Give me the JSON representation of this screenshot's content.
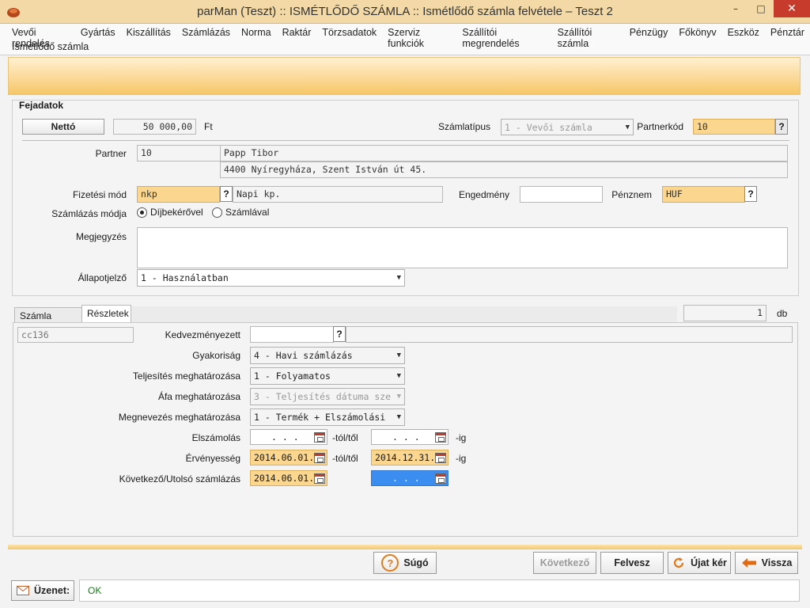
{
  "window": {
    "title": "parMan (Teszt) :: ISMÉTLŐDŐ SZÁMLA :: Ismétlődő számla felvétele   –   Teszt 2",
    "controls": {
      "minimize": "–",
      "maximize": "□",
      "close": "✕"
    }
  },
  "menu": {
    "row1": [
      "Vevői rendelés",
      "Gyártás",
      "Kiszállítás",
      "Számlázás",
      "Norma",
      "Raktár",
      "Törzsadatok",
      "Szerviz funkciók",
      "Szállítói megrendelés",
      "Szállítói számla",
      "Pénzügy",
      "Főkönyv",
      "Eszköz",
      "Pénztár"
    ],
    "row2": [
      "Ismétlődő számla"
    ]
  },
  "header": {
    "section_title": "Fejadatok",
    "netto_button": "Nettó",
    "amount": "50 000,00",
    "currency_unit": "Ft",
    "invoice_type_label": "Számlatípus",
    "invoice_type_value": "1 - Vevői számla",
    "partner_code_label": "Partnerkód",
    "partner_code_value": "10",
    "partner_label": "Partner",
    "partner_id": "10",
    "partner_name": "Papp Tibor",
    "partner_address": "4400 Nyíregyháza, Szent István út 45.",
    "payment_label": "Fizetési mód",
    "payment_code": "nkp",
    "payment_desc": "Napi kp.",
    "discount_label": "Engedmény",
    "discount_value": "",
    "currency_label": "Pénznem",
    "currency_value": "HUF",
    "billing_mode_label": "Számlázás módja",
    "billing_mode_options": [
      "Díjbekérővel",
      "Számlával"
    ],
    "billing_mode_selected": "Díjbekérővel",
    "note_label": "Megjegyzés",
    "note_value": "",
    "status_label": "Állapotjelző",
    "status_value": "1 - Használatban",
    "question_mark": "?"
  },
  "tabs": {
    "items": [
      "Számla tételek",
      "Részletek"
    ],
    "active": "Részletek",
    "count_value": "1",
    "count_unit": "db"
  },
  "details": {
    "code_value": "cc136",
    "beneficiary_label": "Kedvezményezett",
    "beneficiary_value": "",
    "frequency_label": "Gyakoriság",
    "frequency_value": "4 - Havi számlázás",
    "fulfillment_label": "Teljesítés meghatározása",
    "fulfillment_value": "1 - Folyamatos",
    "vat_label": "Áfa meghatározása",
    "vat_value": "3 - Teljesítés dátuma sze",
    "naming_label": "Megnevezés meghatározása",
    "naming_value": "1 - Termék + Elszámolási",
    "settlement_label": "Elszámolás",
    "settlement_from": ". . .",
    "settlement_to": ". . .",
    "validity_label": "Érvényesség",
    "validity_from": "2014.06.01.",
    "validity_to": "2014.12.31.",
    "next_last_label": "Következő/Utolsó számlázás",
    "next_value": "2014.06.01.",
    "last_value": ". . .",
    "from_suffix": "-tól/től",
    "to_suffix": "-ig"
  },
  "buttons": {
    "help": "Súgó",
    "next": "Következő",
    "save": "Felvesz",
    "new": "Újat kér",
    "back": "Vissza"
  },
  "statusbar": {
    "label": "Üzenet:",
    "message": "OK"
  },
  "colors": {
    "orange_field": "#fbd68e",
    "banner_bottom": "#f6c766",
    "selected_blue": "#3b8ef0",
    "close_red": "#c73b2c",
    "ok_text": "#1b7a1b"
  }
}
